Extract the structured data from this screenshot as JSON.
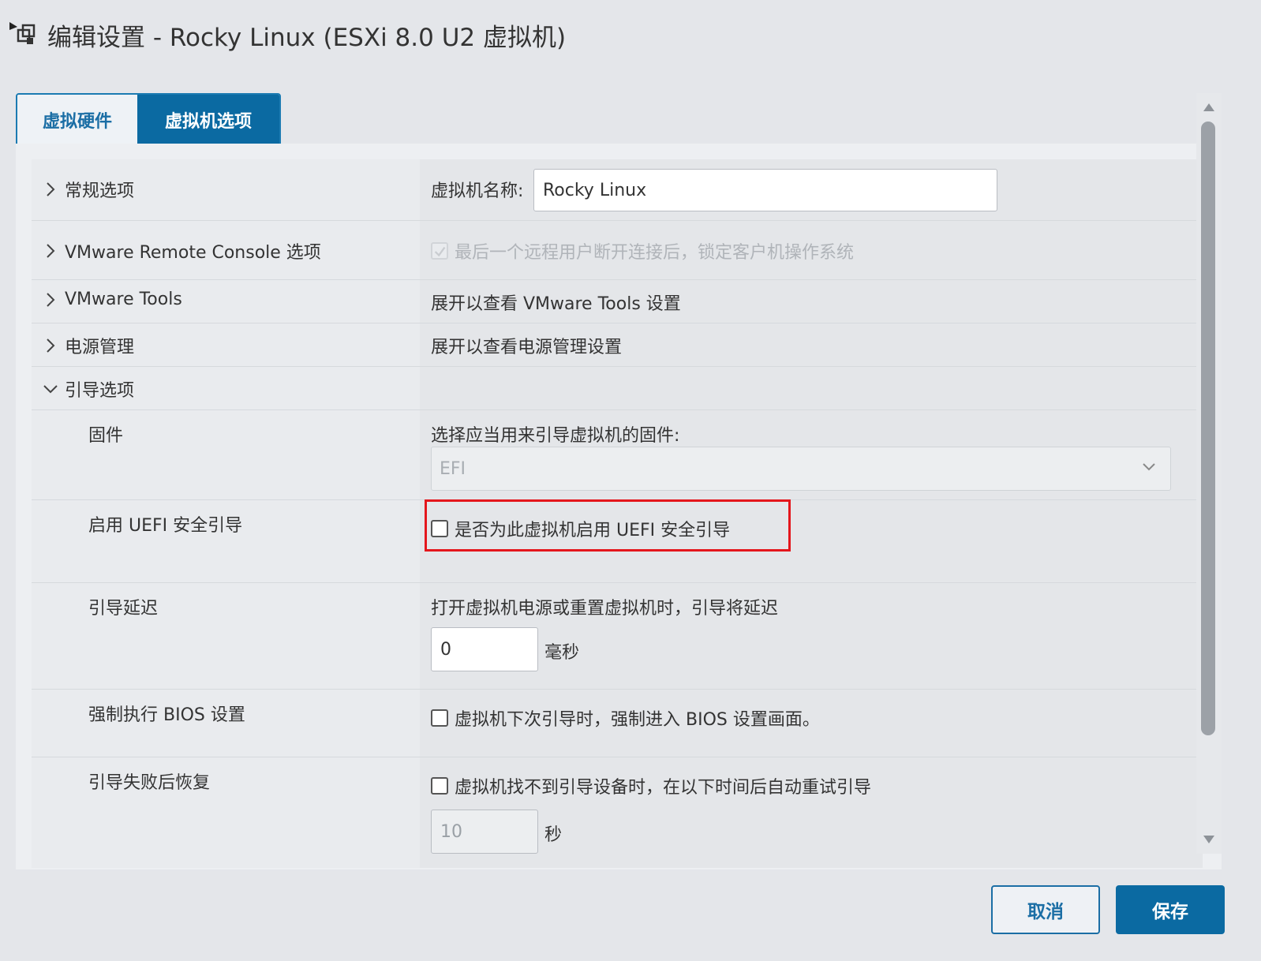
{
  "window": {
    "title": "编辑设置 - Rocky Linux (ESXi 8.0 U2 虚拟机)",
    "icon": "vm-edit-icon"
  },
  "tabs": [
    {
      "label": "虚拟硬件",
      "active": false
    },
    {
      "label": "虚拟机选项",
      "active": true
    }
  ],
  "sections": {
    "general": {
      "label": "常规选项",
      "name_label": "虚拟机名称:",
      "name_value": "Rocky Linux"
    },
    "vmrc": {
      "label": "VMware Remote Console 选项",
      "lock_text": "最后一个远程用户断开连接后，锁定客户机操作系统",
      "lock_checked": true,
      "lock_disabled": true
    },
    "tools": {
      "label": "VMware Tools",
      "summary": "展开以查看 VMware Tools 设置"
    },
    "power": {
      "label": "电源管理",
      "summary": "展开以查看电源管理设置"
    },
    "boot": {
      "label": "引导选项",
      "expanded": true,
      "firmware": {
        "label": "固件",
        "prompt": "选择应当用来引导虚拟机的固件:",
        "value": "EFI"
      },
      "secure_boot": {
        "label": "启用 UEFI 安全引导",
        "text": "是否为此虚拟机启用 UEFI 安全引导",
        "checked": false
      },
      "delay": {
        "label": "引导延迟",
        "prompt": "打开虚拟机电源或重置虚拟机时，引导将延迟",
        "value": "0",
        "unit": "毫秒"
      },
      "force_bios": {
        "label": "强制执行 BIOS 设置",
        "text": "虚拟机下次引导时，强制进入 BIOS 设置画面。",
        "checked": false
      },
      "recovery": {
        "label": "引导失败后恢复",
        "text": "虚拟机找不到引导设备时，在以下时间后自动重试引导",
        "checked": false,
        "value": "10",
        "unit": "秒"
      }
    }
  },
  "footer": {
    "cancel_label": "取消",
    "save_label": "保存"
  },
  "colors": {
    "accent": "#0b6aa2",
    "highlight": "#e4161c"
  }
}
